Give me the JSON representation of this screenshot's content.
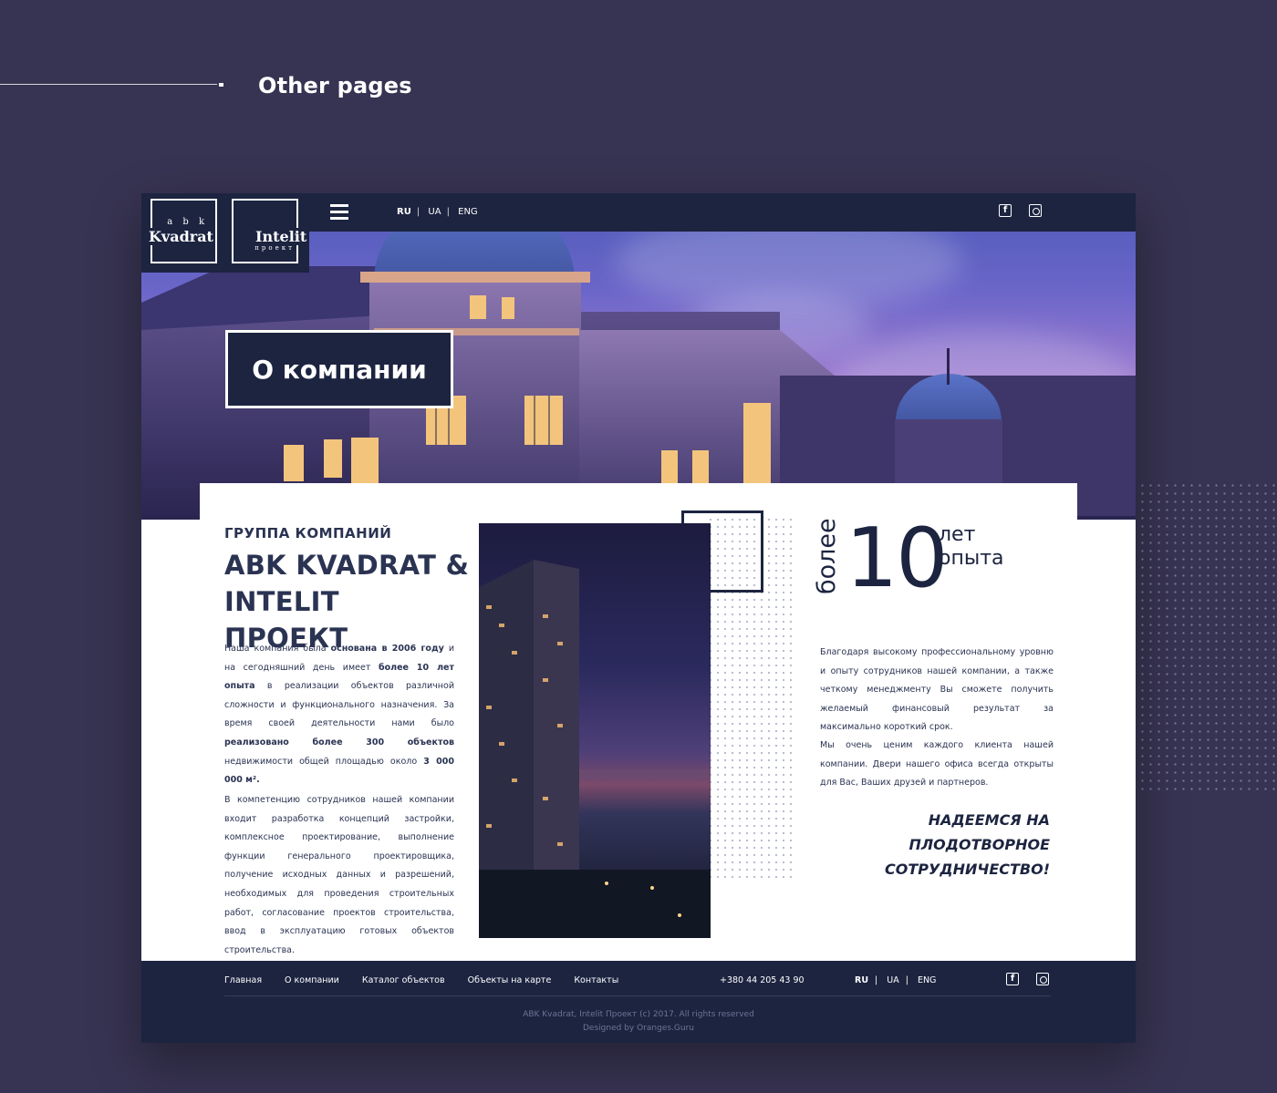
{
  "presentation": {
    "title": "Other pages"
  },
  "header": {
    "logo_kvadrat_small": "a b k",
    "logo_kvadrat_main": "Kvadrat",
    "logo_intelit_main": "Intelit",
    "logo_intelit_sub": "проект",
    "languages": [
      "RU",
      "UA",
      "ENG"
    ],
    "active_language": "RU",
    "social": [
      "facebook-icon",
      "instagram-icon"
    ]
  },
  "hero": {
    "title": "О компании"
  },
  "about": {
    "kicker": "ГРУППА КОМПАНИЙ",
    "title": "ABK KVADRAT & INTELIT ПРОЕКТ",
    "para1": {
      "t1": "Наша компания была ",
      "b1": "основана в 2006 году",
      "t2": " и на сегодняшний день имеет ",
      "b2": "более 10 лет опыта",
      "t3": " в реализации объектов различной сложности и функционального назначения. За время своей деятельности нами было ",
      "b3": "реализовано более 300 объектов",
      "t4": " недвижимости общей площадью около ",
      "b4": "3 000 000 м².",
      "t5": ""
    },
    "para2": "В компетенцию сотрудников нашей компании входит разработка концепций застройки, комплексное проектирование, выполнение функции генерального проектировщика, получение исходных данных и разрешений, необходимых для проведения строительных работ, согласование проектов строительства, ввод в эксплуатацию готовых объектов строительства."
  },
  "experience": {
    "prefix": "более",
    "number": "10",
    "label_line1": "лет",
    "label_line2": "опыта",
    "para1": "Благодаря высокому профессиональному уровню и опыту сотрудников нашей компании, а также четкому менеджменту Вы сможете получить желаемый финансовый результат за максимально короткий срок.",
    "para2": "Мы очень ценим каждого клиента нашей компании. Двери нашего офиса всегда открыты для Вас, Ваших друзей и партнеров.",
    "closing": "НАДЕЕМСЯ НА ПЛОДОТВОРНОЕ СОТРУДНИЧЕСТВО!"
  },
  "footer": {
    "nav": [
      "Главная",
      "О компании",
      "Каталог объектов",
      "Объекты на карте",
      "Контакты"
    ],
    "phone": "+380 44 205 43 90",
    "languages": [
      "RU",
      "UA",
      "ENG"
    ],
    "copyright": "ABK Kvadrat, Intelit Проект (c) 2017. All rights reserved",
    "designed_by": "Designed by Oranges.Guru"
  },
  "colors": {
    "background": "#373352",
    "navy": "#1c2440",
    "text": "#2a3352"
  }
}
